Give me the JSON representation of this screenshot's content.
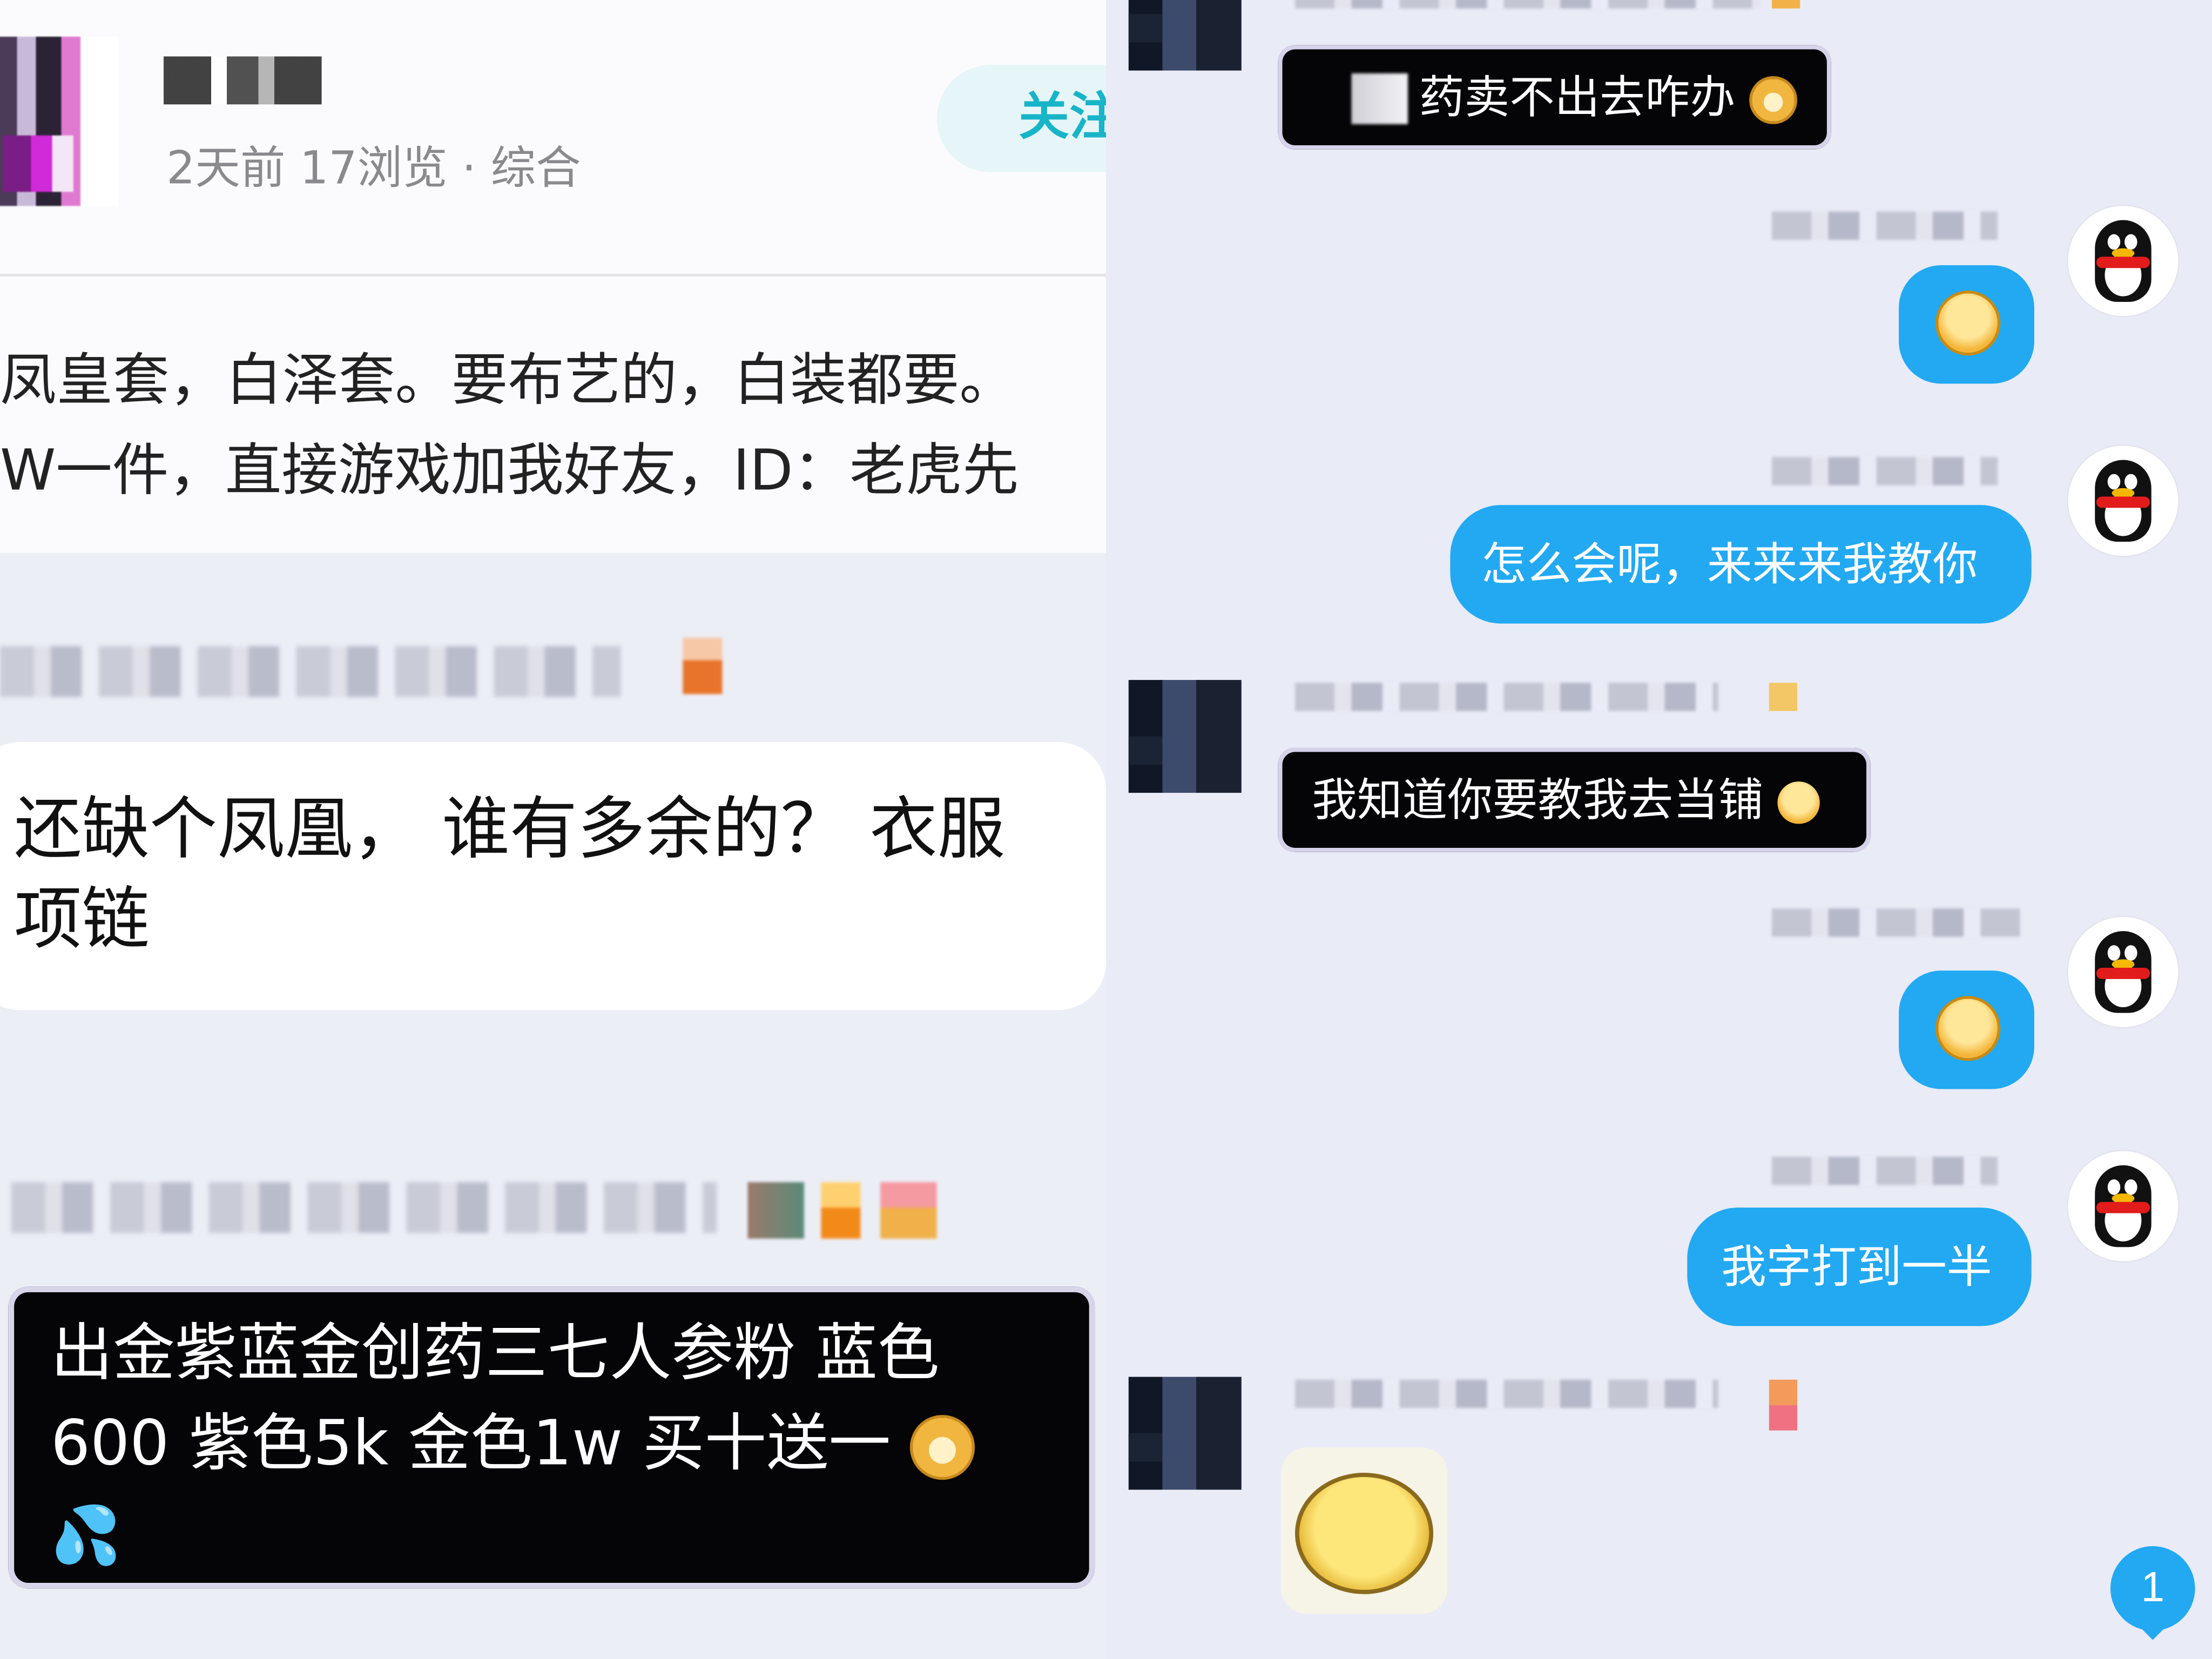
{
  "left_post": {
    "meta": "2天前 17浏览 · 综合",
    "follow_label": "关注",
    "body_line1": "凤皇套，白泽套。要布艺的，白装都要。",
    "body_line2": "W一件，直接游戏加我好友，ID：老虎先"
  },
  "left_comments": {
    "white_bubble_line1": "还缺个凤凰， 谁有多余的？ 衣服",
    "white_bubble_line2": "项链",
    "dark_bubble_line1": "出金紫蓝金创药三七人参粉  蓝色",
    "dark_bubble_line2": "600 紫色5k 金色1w 买十送一"
  },
  "chat": {
    "msg1": "药卖不出去咋办",
    "msg2": "怎么会呢，来来来我教你",
    "msg3": "我知道你要教我去当铺",
    "msg4": "我字打到一半",
    "unread_count": "1"
  },
  "icons": {
    "qq_avatar": "qq-penguin-icon",
    "cat_emoji": "cat-face-emoji-icon",
    "drops_emoji": "sweat-drops-icon",
    "grin_emoji": "grin-emoji-icon",
    "sad_emoji": "sad-emoji-icon",
    "sticker": "laughing-face-sticker-icon"
  },
  "colors": {
    "qq_blue": "#22a9f2",
    "follow_teal": "#18b4c8",
    "dark_bubble": "#050507",
    "panel_bg": "#eceef6"
  }
}
